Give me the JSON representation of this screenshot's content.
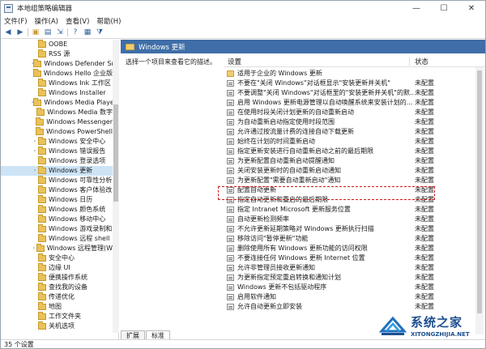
{
  "window": {
    "title": "本地组策略编辑器",
    "minimize": "—",
    "maximize": "☐",
    "close": "✕"
  },
  "menubar": [
    "文件(F)",
    "操作(A)",
    "查看(V)",
    "帮助(H)"
  ],
  "toolbar": [
    "back-arrow-icon",
    "forward-arrow-icon",
    "up-folder-icon",
    "show-hide-tree-icon",
    "export-icon",
    "help-icon",
    "properties-icon",
    "filter-icon"
  ],
  "tree": {
    "items": [
      {
        "label": "OOBE",
        "arrow": ""
      },
      {
        "label": "RSS 源",
        "arrow": ""
      },
      {
        "label": "Windows Defender Sr",
        "arrow": "›"
      },
      {
        "label": "Windows Hello 企业版",
        "arrow": ""
      },
      {
        "label": "Windows Ink 工作区",
        "arrow": ""
      },
      {
        "label": "Windows Installer",
        "arrow": ""
      },
      {
        "label": "Windows Media Playe",
        "arrow": "›"
      },
      {
        "label": "Windows Media 数字",
        "arrow": ""
      },
      {
        "label": "Windows Messenger",
        "arrow": ""
      },
      {
        "label": "Windows PowerShell",
        "arrow": ""
      },
      {
        "label": "Windows 安全中心",
        "arrow": "›"
      },
      {
        "label": "Windows 错误报告",
        "arrow": "›"
      },
      {
        "label": "Windows 登录选项",
        "arrow": ""
      },
      {
        "label": "Windows 更新",
        "arrow": "›",
        "selected": true
      },
      {
        "label": "Windows 可靠性分析",
        "arrow": ""
      },
      {
        "label": "Windows 客户体验改",
        "arrow": ""
      },
      {
        "label": "Windows 日历",
        "arrow": ""
      },
      {
        "label": "Windows 颜色系统",
        "arrow": ""
      },
      {
        "label": "Windows 移动中心",
        "arrow": ""
      },
      {
        "label": "Windows 游戏录制和",
        "arrow": ""
      },
      {
        "label": "Windows 远程 shell",
        "arrow": ""
      },
      {
        "label": "Windows 远程管理(W",
        "arrow": "›"
      },
      {
        "label": "安全中心",
        "arrow": ""
      },
      {
        "label": "边缘 UI",
        "arrow": ""
      },
      {
        "label": "便携操作系统",
        "arrow": ""
      },
      {
        "label": "查找我的设备",
        "arrow": ""
      },
      {
        "label": "传递优化",
        "arrow": ""
      },
      {
        "label": "地图",
        "arrow": ""
      },
      {
        "label": "工作文件夹",
        "arrow": ""
      },
      {
        "label": "关机选项",
        "arrow": ""
      }
    ]
  },
  "panel": {
    "header": "Windows 更新",
    "description": "选择一个项目来查看它的描述。",
    "col_setting": "设置",
    "col_state": "状态"
  },
  "settings": [
    {
      "text": "适用于企业的 Windows 更新",
      "state": "",
      "folder": true
    },
    {
      "text": "不要在\"关闭 Windows\"对话框显示\"安装更新并关机\"",
      "state": "未配置"
    },
    {
      "text": "不要调整\"关闭 Windows\"对话框里的\"安装更新并关机\"的默...",
      "state": "未配置"
    },
    {
      "text": "启用 Windows 更新电源管理以自动唤醒系统来安装计划的...",
      "state": "未配置"
    },
    {
      "text": "在使用时段关闭计划更新的自动重新启动",
      "state": "未配置"
    },
    {
      "text": "为自动重新启动指定使用时段范围",
      "state": "未配置"
    },
    {
      "text": "允许通过按流量计费的连接自动下载更新",
      "state": "未配置"
    },
    {
      "text": "始终在计划的时间重新启动",
      "state": "未配置"
    },
    {
      "text": "指定更新安装进行自动重新启动之前的最后期限",
      "state": "未配置"
    },
    {
      "text": "为更新配置自动重新启动提醒通知",
      "state": "未配置"
    },
    {
      "text": "关闭安装更新时的自动重新启动通知",
      "state": "未配置"
    },
    {
      "text": "为更新配置\"需要自动重新启动\"通知",
      "state": "未配置"
    },
    {
      "text": "配置自动更新",
      "state": "未配置"
    },
    {
      "text": "指定自动更新和重启的最后期限",
      "state": "未配置"
    },
    {
      "text": "指定 Intranet Microsoft 更新服务位置",
      "state": "未配置"
    },
    {
      "text": "自动更新检测频率",
      "state": "未配置"
    },
    {
      "text": "不允许更新延期策略对 Windows 更新执行扫描",
      "state": "未配置"
    },
    {
      "text": "移除访问\"暂停更新\"功能",
      "state": "未配置"
    },
    {
      "text": "删除使用所有 Windows 更新功能的访问权限",
      "state": "未配置"
    },
    {
      "text": "不要连接任何 Windows 更新 Internet 位置",
      "state": "未配置"
    },
    {
      "text": "允许非管理员接收更新通知",
      "state": "未配置"
    },
    {
      "text": "为更新指定预定重启转换和通知计划",
      "state": "未配置"
    },
    {
      "text": "Windows 更新不包括驱动程序",
      "state": "未配置"
    },
    {
      "text": "启用软件通知",
      "state": "未配置"
    },
    {
      "text": "允许自动更新立即安装",
      "state": "未配置"
    }
  ],
  "tabs": [
    "扩展",
    "标准"
  ],
  "status": "35 个设置",
  "watermark": {
    "brand": "系统之家",
    "url": "XITONGZHIJIA.NET"
  },
  "colors": {
    "header_bg": "#3f6ea8",
    "highlight": "#d01818",
    "selection": "#cde4f7"
  }
}
